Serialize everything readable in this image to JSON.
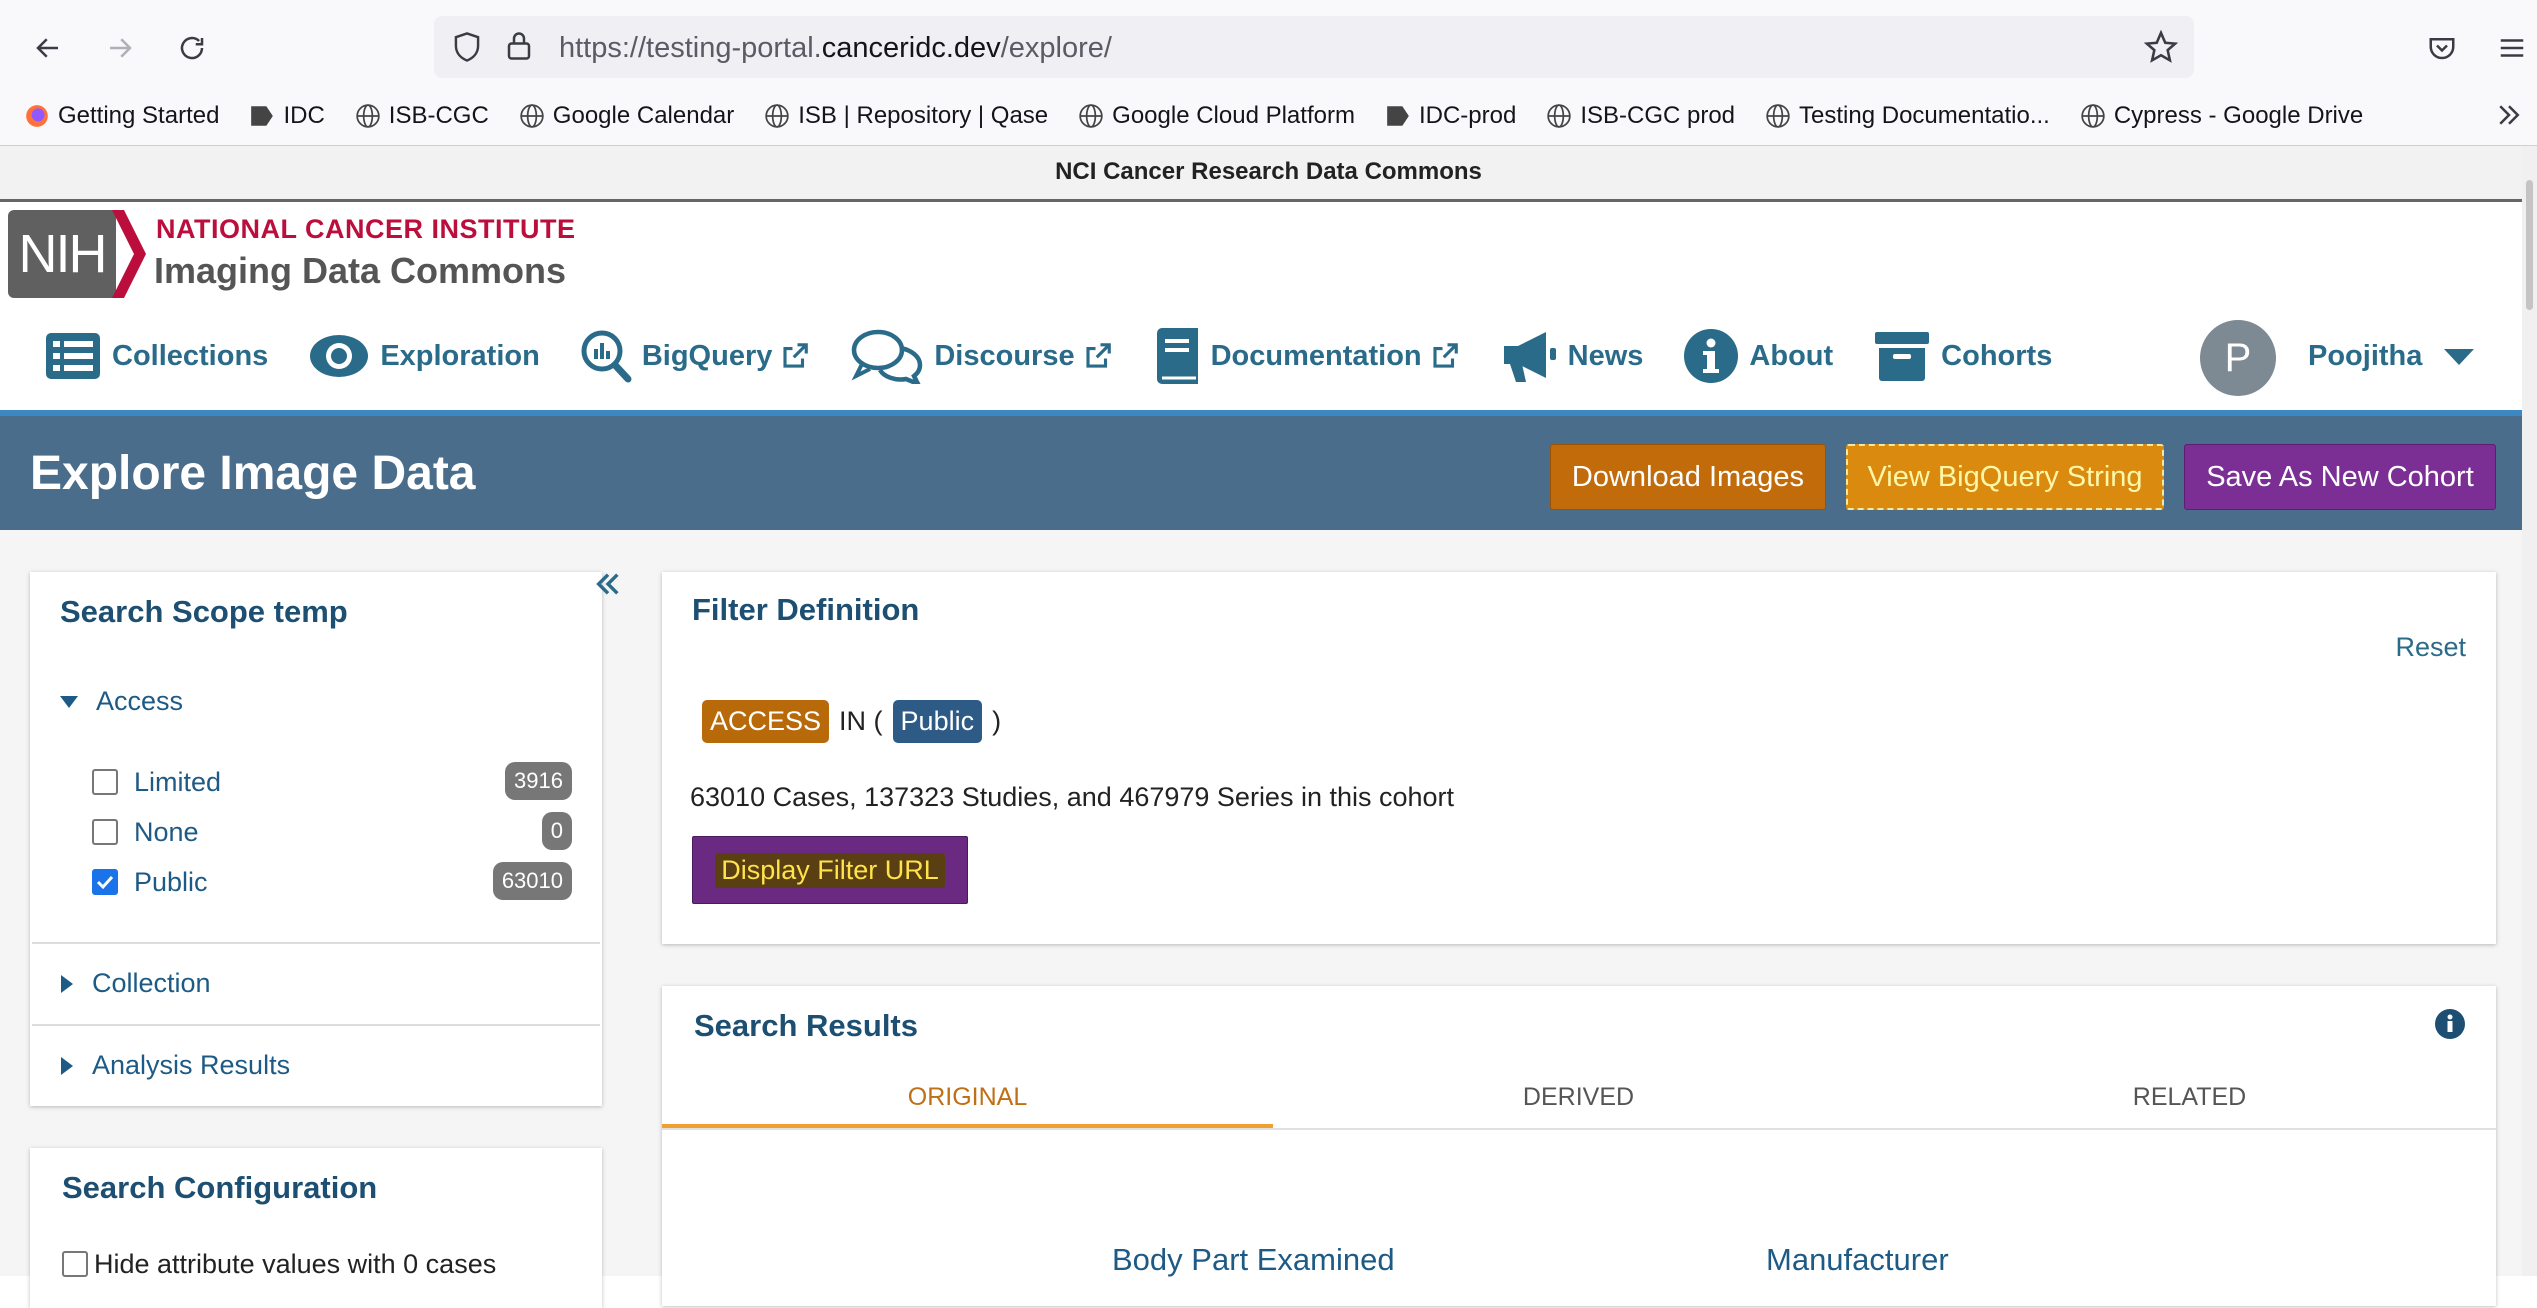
{
  "browser": {
    "url_prefix": "https://testing-portal.",
    "url_host": "canceridc.dev",
    "url_path": "/explore/",
    "bookmarks": [
      {
        "label": "Getting Started",
        "icon": "firefox-icon"
      },
      {
        "label": "IDC",
        "icon": "idc-bookmark-icon"
      },
      {
        "label": "ISB-CGC",
        "icon": "globe-icon"
      },
      {
        "label": "Google Calendar",
        "icon": "globe-icon"
      },
      {
        "label": "ISB | Repository | Qase",
        "icon": "globe-icon"
      },
      {
        "label": "Google Cloud Platform",
        "icon": "globe-icon"
      },
      {
        "label": "IDC-prod",
        "icon": "idc-bookmark-icon"
      },
      {
        "label": "ISB-CGC prod",
        "icon": "globe-icon"
      },
      {
        "label": "Testing Documentatio...",
        "icon": "globe-icon"
      },
      {
        "label": "Cypress - Google Drive",
        "icon": "globe-icon"
      }
    ]
  },
  "crdc_banner": "NCI Cancer Research Data Commons",
  "header": {
    "logo_text": "NIH",
    "nci_title": "NATIONAL CANCER INSTITUTE",
    "idc_title": "Imaging Data Commons",
    "nav": {
      "collections": "Collections",
      "exploration": "Exploration",
      "bigquery": "BigQuery",
      "discourse": "Discourse",
      "documentation": "Documentation",
      "news": "News",
      "about": "About",
      "cohorts": "Cohorts"
    },
    "user_initial": "P",
    "user_name": "Poojitha"
  },
  "banner": {
    "title": "Explore Image Data",
    "download_label": "Download Images",
    "bigquery_label": "View BigQuery String",
    "save_label": "Save As New Cohort"
  },
  "search_scope": {
    "title": "Search Scope temp",
    "access_label": "Access",
    "facets": [
      {
        "label": "Limited",
        "count": "3916",
        "checked": false
      },
      {
        "label": "None",
        "count": "0",
        "checked": false
      },
      {
        "label": "Public",
        "count": "63010",
        "checked": true
      }
    ],
    "collection_label": "Collection",
    "analysis_label": "Analysis Results"
  },
  "search_config": {
    "title": "Search Configuration",
    "hide_zero_label": "Hide attribute values with 0 cases"
  },
  "filter_definition": {
    "title": "Filter Definition",
    "reset_label": "Reset",
    "chip_attr": "ACCESS",
    "in_text": "IN (",
    "chip_value": "Public",
    "close_paren": ")",
    "summary": "63010 Cases, 137323 Studies, and 467979 Series in this cohort",
    "display_url_label": "Display Filter URL"
  },
  "search_results": {
    "title": "Search Results",
    "tabs": [
      "ORIGINAL",
      "DERIVED",
      "RELATED"
    ],
    "chart_titles": [
      "Body Part Examined",
      "Manufacturer"
    ]
  },
  "colors": {
    "brand_red": "#bb0e3d",
    "nav_teal": "#2a6b8a",
    "banner_blue": "#4a6d8c",
    "download_orange": "#c16b0b",
    "save_purple": "#7b2f95",
    "active_tab": "#c07014"
  }
}
